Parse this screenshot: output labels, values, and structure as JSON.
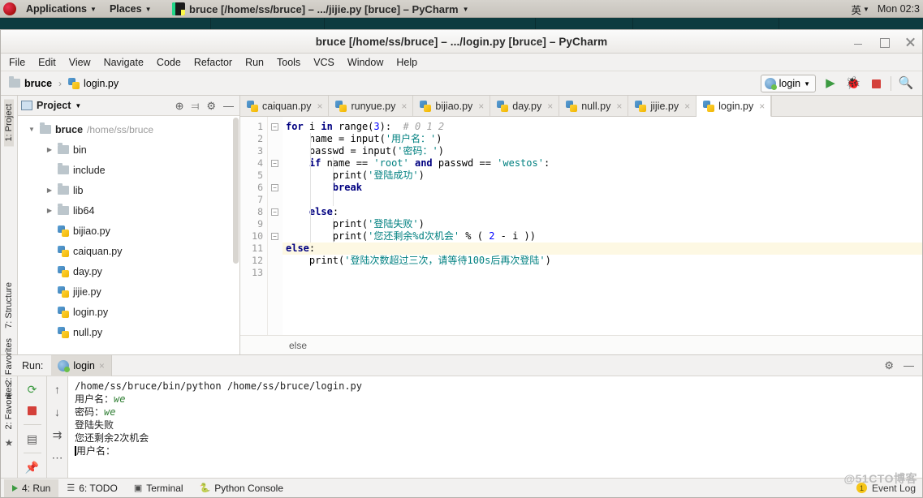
{
  "gnome": {
    "applications": "Applications",
    "places": "Places",
    "window_title": "bruce [/home/ss/bruce] – .../jijie.py [bruce] – PyCharm",
    "input_method": "英",
    "clock": "Mon 02:3"
  },
  "window": {
    "title": "bruce [/home/ss/bruce] – .../login.py [bruce] – PyCharm",
    "controls": {
      "minimize": "minimize",
      "maximize": "maximize",
      "close": "close"
    }
  },
  "menubar": [
    "File",
    "Edit",
    "View",
    "Navigate",
    "Code",
    "Refactor",
    "Run",
    "Tools",
    "VCS",
    "Window",
    "Help"
  ],
  "navbar": {
    "crumbs": [
      {
        "label": "bruce",
        "icon": "folder-icon"
      },
      {
        "label": "login.py",
        "icon": "python-file-icon"
      }
    ],
    "separator": "›",
    "run_config": "login",
    "run_icon": "run-icon",
    "debug_icon": "debug-icon",
    "stop_icon": "stop-icon",
    "search_icon": "search-icon"
  },
  "left_strip": {
    "project_tab": "1: Project",
    "structure_tab": "7: Structure",
    "favorites_tab": "2: Favorites"
  },
  "project_panel": {
    "title": "Project",
    "actions": [
      "locate-icon",
      "collapse-all-icon",
      "settings-icon",
      "hide-icon"
    ],
    "tree": [
      {
        "label": "bruce",
        "path": "/home/ss/bruce",
        "icon": "folder-icon",
        "arrow": "▼",
        "bold": true,
        "indent": 0
      },
      {
        "label": "bin",
        "path": "",
        "icon": "folder-icon",
        "arrow": "▶",
        "bold": false,
        "indent": 1
      },
      {
        "label": "include",
        "path": "",
        "icon": "folder-icon",
        "arrow": "",
        "bold": false,
        "indent": 1
      },
      {
        "label": "lib",
        "path": "",
        "icon": "folder-icon",
        "arrow": "▶",
        "bold": false,
        "indent": 1
      },
      {
        "label": "lib64",
        "path": "",
        "icon": "folder-link-icon",
        "arrow": "▶",
        "bold": false,
        "indent": 1
      },
      {
        "label": "bijiao.py",
        "path": "",
        "icon": "python-file-icon",
        "arrow": "",
        "bold": false,
        "indent": 1
      },
      {
        "label": "caiquan.py",
        "path": "",
        "icon": "python-file-icon",
        "arrow": "",
        "bold": false,
        "indent": 1
      },
      {
        "label": "day.py",
        "path": "",
        "icon": "python-file-icon",
        "arrow": "",
        "bold": false,
        "indent": 1
      },
      {
        "label": "jijie.py",
        "path": "",
        "icon": "python-file-icon",
        "arrow": "",
        "bold": false,
        "indent": 1
      },
      {
        "label": "login.py",
        "path": "",
        "icon": "python-file-icon",
        "arrow": "",
        "bold": false,
        "indent": 1
      },
      {
        "label": "null.py",
        "path": "",
        "icon": "python-file-icon",
        "arrow": "",
        "bold": false,
        "indent": 1
      }
    ]
  },
  "editor": {
    "tabs": [
      {
        "label": "caiquan.py",
        "active": false
      },
      {
        "label": "runyue.py",
        "active": false
      },
      {
        "label": "bijiao.py",
        "active": false
      },
      {
        "label": "day.py",
        "active": false
      },
      {
        "label": "null.py",
        "active": false
      },
      {
        "label": "jijie.py",
        "active": false
      },
      {
        "label": "login.py",
        "active": true
      }
    ],
    "close_glyph": "×",
    "line_numbers": [
      "1",
      "2",
      "3",
      "4",
      "5",
      "6",
      "7",
      "8",
      "9",
      "10",
      "11",
      "12",
      "13"
    ],
    "highlight_line": 11,
    "breadcrumb": "else",
    "lines": [
      "for i in range(3):  # 0 1 2",
      "    name = input('用户名：')",
      "    passwd = input('密码：')",
      "    if name == 'root' and passwd == 'westos':",
      "        print('登陆成功')",
      "        break",
      "",
      "    else:",
      "        print('登陆失败')",
      "        print('您还剩余%d次机会' % ( 2 - i ))",
      "else:",
      "    print('登陆次数超过三次，请等待100s后再次登陆')",
      ""
    ]
  },
  "run_panel": {
    "label": "Run:",
    "tab": "login",
    "close_glyph": "×",
    "settings_icon": "gear-icon",
    "hide_icon": "hide-icon",
    "toolbar_icons": [
      "rerun-icon",
      "scroll-up-icon",
      "stop-icon",
      "scroll-down-icon",
      "print-icon",
      "soft-wrap-icon",
      "pin-icon",
      "expand-icon"
    ],
    "console": [
      {
        "text": "/home/ss/bruce/bin/python /home/ss/bruce/login.py",
        "input": ""
      },
      {
        "text": "用户名：",
        "input": "we"
      },
      {
        "text": "密码：",
        "input": "we"
      },
      {
        "text": "登陆失败",
        "input": ""
      },
      {
        "text": "您还剩余2次机会",
        "input": ""
      },
      {
        "text": "用户名：",
        "input": ""
      }
    ]
  },
  "status_bar": {
    "items": [
      {
        "label": "4: Run",
        "icon": "run-icon",
        "selected": true
      },
      {
        "label": "6: TODO",
        "icon": "todo-icon",
        "selected": false
      },
      {
        "label": "Terminal",
        "icon": "terminal-icon",
        "selected": false
      },
      {
        "label": "Python Console",
        "icon": "python-icon",
        "selected": false
      }
    ],
    "event_log": "Event Log",
    "event_badge": "1",
    "watermark": "@51CTO博客"
  }
}
